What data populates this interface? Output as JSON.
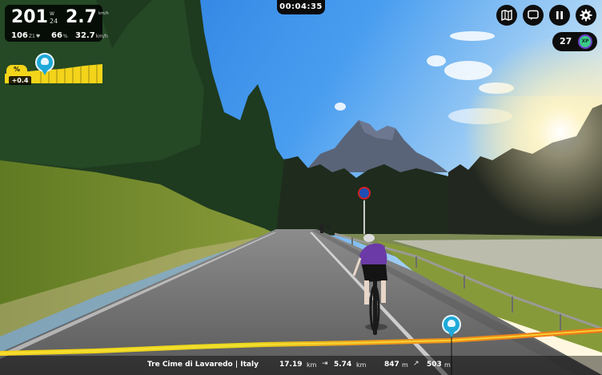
{
  "ride": {
    "power": "201",
    "power_unit": "W",
    "power_3s": "24",
    "speed": "2.7",
    "speed_unit": "km/h",
    "heart_rate": "106",
    "heart_rate_zone": "Z1",
    "cadence": "66",
    "cadence_unit": "%",
    "avg_speed": "32.7",
    "avg_speed_unit": "km/h"
  },
  "grade": {
    "label": "%",
    "value": "+0.4"
  },
  "timer": "00:04:35",
  "controls": {
    "map_icon": "map-icon",
    "chat_icon": "chat-icon",
    "pause_icon": "pause-icon",
    "settings_icon": "gear-icon"
  },
  "xp": {
    "value": "27",
    "badge": "XP"
  },
  "bottom_bar": {
    "route_name": "Tre Cime di Lavaredo | Italy",
    "distance": "17.19",
    "distance_unit": "km",
    "remaining": "5.74",
    "remaining_unit": "km",
    "elevation": "847",
    "elevation_unit": "m",
    "climb": "503",
    "climb_unit": "m"
  },
  "colors": {
    "profile_yellow": "#f3d41a",
    "marker_blue": "#1fa9d8",
    "xp_green": "#3cc98a"
  }
}
